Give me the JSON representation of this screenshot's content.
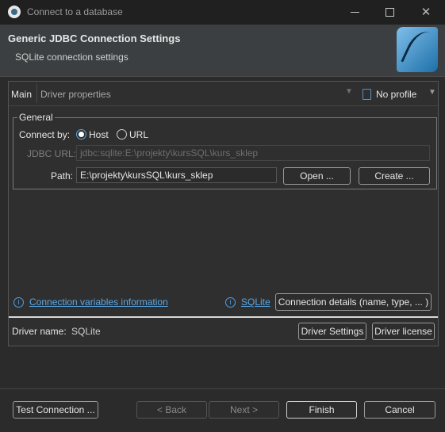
{
  "window": {
    "title": "Connect to a database",
    "minimize_label": "Minimize",
    "maximize_label": "Maximize",
    "close_label": "✕"
  },
  "header": {
    "title": "Generic JDBC Connection Settings",
    "subtitle": "SQLite connection settings",
    "logo_icon": "sqlite-feather-logo"
  },
  "tabs": {
    "main": "Main",
    "driver_properties": "Driver properties",
    "profile": "No profile"
  },
  "general": {
    "legend": "General",
    "connect_by_label": "Connect by:",
    "option_host": "Host",
    "option_url": "URL",
    "selected": "Host",
    "jdbc_url_label": "JDBC URL:",
    "jdbc_url_value": "jdbc:sqlite:E:\\projekty\\kursSQL\\kurs_sklep",
    "path_label": "Path:",
    "path_value": "E:\\projekty\\kursSQL\\kurs_sklep",
    "open_button": "Open ...",
    "create_button": "Create ..."
  },
  "links": {
    "connection_variables": "Connection variables information",
    "sqlite": "SQLite",
    "connection_details_button": "Connection details (name, type, ... )"
  },
  "driver": {
    "name_label": "Driver name:",
    "name_value": "SQLite",
    "settings_button": "Driver Settings",
    "license_button": "Driver license"
  },
  "footer": {
    "test_connection": "Test Connection ...",
    "back": "< Back",
    "next": "Next >",
    "finish": "Finish",
    "cancel": "Cancel"
  },
  "colors": {
    "accent": "#5aa7e6",
    "background": "#2b2b2b",
    "header": "#3c3f41"
  }
}
